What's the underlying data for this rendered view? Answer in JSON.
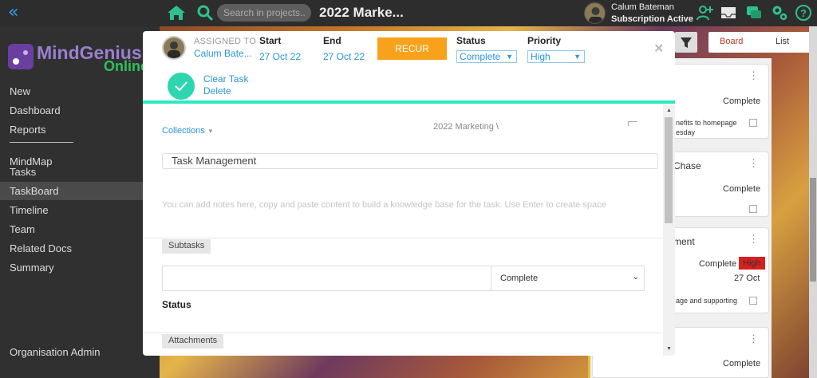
{
  "topbar": {
    "search_placeholder": "Search in projects...",
    "project_title": "2022 Marke...",
    "user_name": "Calum Bateman",
    "subscription": "Subscription Active"
  },
  "sidebar": {
    "logo_text": "MindGenius",
    "logo_sub": "Online",
    "items": [
      {
        "label": "New"
      },
      {
        "label": "Dashboard"
      },
      {
        "label": "Reports"
      },
      {
        "label": "MindMap"
      },
      {
        "label": "Tasks"
      },
      {
        "label": "TaskBoard"
      },
      {
        "label": "Timeline"
      },
      {
        "label": "Team"
      },
      {
        "label": "Related Docs"
      },
      {
        "label": "Summary"
      }
    ],
    "admin": "Organisation Admin"
  },
  "board": {
    "tabs": {
      "board": "Board",
      "list": "List"
    },
    "cards": [
      {
        "status": "Complete",
        "desc1": "nefits to homepage",
        "desc2": "esday"
      },
      {
        "title": "Chase",
        "status": "Complete"
      },
      {
        "title": "ment",
        "status": "Complete",
        "priority": "High",
        "date": "27 Oct",
        "desc1": "age and supporting"
      },
      {
        "status": "Complete"
      }
    ]
  },
  "modal": {
    "assigned_label": "ASSIGNED TO",
    "assigned_name": "Calum Bate...",
    "start_label": "Start",
    "start_value": "27 Oct 22",
    "end_label": "End",
    "end_value": "27 Oct 22",
    "recur_label": "RECUR",
    "status_label": "Status",
    "status_value": "Complete",
    "priority_label": "Priority",
    "priority_value": "High",
    "clear_task": "Clear Task",
    "delete": "Delete",
    "collections": "Collections",
    "path": "2022 Marketing \\",
    "task_title": "Task Management",
    "notes_placeholder": "You can add notes here, copy and paste content to build a knowledge base for the task. Use Enter to create space",
    "subtasks_label": "Subtasks",
    "subtask_status": "Complete",
    "status_heading": "Status",
    "attachments_label": "Attachments"
  },
  "colors": {
    "accent_blue": "#2a95d5",
    "recur_orange": "#f7a21a",
    "teal": "#2ed6b0",
    "high_red": "#d9201f"
  }
}
